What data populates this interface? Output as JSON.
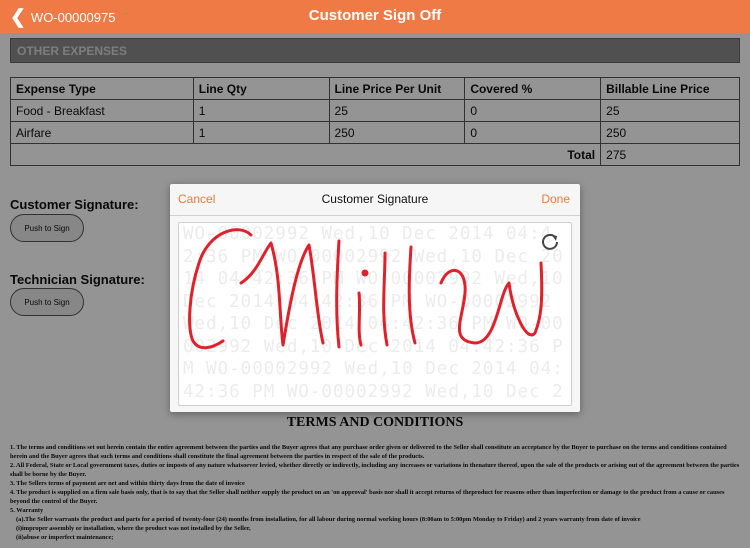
{
  "nav": {
    "back_label": "WO-00000975",
    "title": "Customer Sign Off"
  },
  "other_expenses": {
    "header": "OTHER EXPENSES",
    "columns": [
      "Expense Type",
      "Line Qty",
      "Line Price Per Unit",
      "Covered %",
      "Billable Line Price"
    ],
    "rows": [
      [
        "Food - Breakfast",
        "1",
        "25",
        "0",
        "25"
      ],
      [
        "Airfare",
        "1",
        "250",
        "0",
        "250"
      ]
    ],
    "total_label": "Total",
    "total_value": "275"
  },
  "customer_signature": {
    "label": "Customer Signature:",
    "button": "Push to Sign"
  },
  "technician_signature": {
    "label": "Technician Signature:",
    "button": "Push to Sign"
  },
  "terms": {
    "title": "TERMS AND CONDITIONS",
    "lines": [
      "1. The terms and conditions set out herein contain the entire agreement between the parties and the Buyer agrees that any purchase order given or delivered to the Seller shall constitute an acceptance by the Buyer to purchase on the terms and conditions contained herein and the Buyer agrees that such terms and conditions shall constitute the final agreement between the parties in respect of the sale of the products.",
      "2. All Federal, State or Local government taxes, duties or imposts of any nature whatsoever levied, whether directly or indirectly, including any increases or variations in thenature thereof, upon the sale of the products or arising out of the agreement between the parties shall be borne by the Buyer.",
      "3. The Sellers terms of payment are net and within thirty days from the date of invoice",
      "4. The product is supplied on a firm sale basis only, that is to say that the Seller shall neither supply the product on an 'on approval' basis nor shall it accept returns of theproduct for reasons other than imperfection or damage to the product from a cause or causes beyond the control of the Buyer.",
      "5. Warranty",
      "(a).The Seller warrants the product and parts for a period of twenty-four (24) months from installation, for all labour during normal working hours (8:00am to 5:00pm Monday to Friday) and 2 years warranty from date of invoice",
      "(i)improper assembly or installation, where the product was not installed by the Seller,",
      "(ii)abuse or imperfect maintenance;"
    ]
  },
  "modal": {
    "cancel": "Cancel",
    "title": "Customer Signature",
    "done": "Done",
    "refresh_icon": "refresh-icon",
    "watermark": "WO-00002992 Wed,10 Dec 2014 04:42:36 PM WO-00002992 Wed,10 Dec 2014 04:42:36 PM WO-00002992 Wed,10 Dec 2014 04:42:36 PM WO-00002992 Wed,10 Dec 2014 04:42:36 PM WO-00002992 Wed,10 Dec 2014 04:42:36 PM WO-00002992 Wed,10 Dec 2014 04:42:36 PM WO-00002992 Wed,10 Dec 2014 04:42:36 PM",
    "ink_color": "#e0202a"
  },
  "colors": {
    "nav_bg": "#f07a45",
    "accent": "#e87b3c"
  }
}
